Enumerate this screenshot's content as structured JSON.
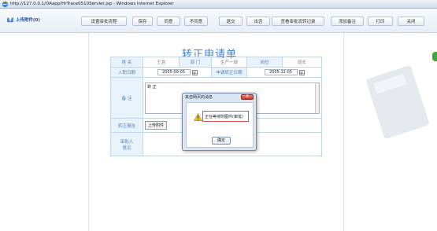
{
  "window": {
    "title": "http://127.0.0.1/OAapp/HrTrace0510Servlet.jsp - Windows Internet Explorer"
  },
  "toolbar": {
    "upload_label": "上传附件(0)",
    "buttons": [
      {
        "label": "设置审批流程"
      },
      {
        "label": "保存"
      },
      {
        "label": "同意"
      },
      {
        "label": "不同意"
      },
      {
        "label": "退交"
      },
      {
        "label": "出否"
      },
      {
        "label": "查看审批流转记录"
      },
      {
        "label": "添加备注"
      },
      {
        "label": "打印"
      },
      {
        "label": "关闭"
      }
    ]
  },
  "form": {
    "title": "转正申请单",
    "name_label": "姓 名",
    "name_value": "王浩",
    "dept_label": "部 门",
    "dept_value": "生产一部",
    "position_label": "岗位",
    "position_value": "班长",
    "entry_date_label": "入职日期",
    "entry_date_value": "2005-09-05",
    "apply_date_label": "申请转正日期",
    "apply_date_value": "2005-12-05",
    "remark_label": "备 注",
    "remark_value": "转 正",
    "report_label": "转正报告",
    "upload_attachment_label": "上传附件",
    "approver_label": "审批人\n意见"
  },
  "dialog": {
    "title": "来自网页的消息",
    "close_label": "X",
    "message": "正在等待附图件(审批)",
    "ok_label": "确定"
  },
  "colors": {
    "accent": "#3b7fd0",
    "label_bg": "#e8f2fb",
    "border": "#bfd6ec",
    "warning_outline": "#e34b4b"
  }
}
